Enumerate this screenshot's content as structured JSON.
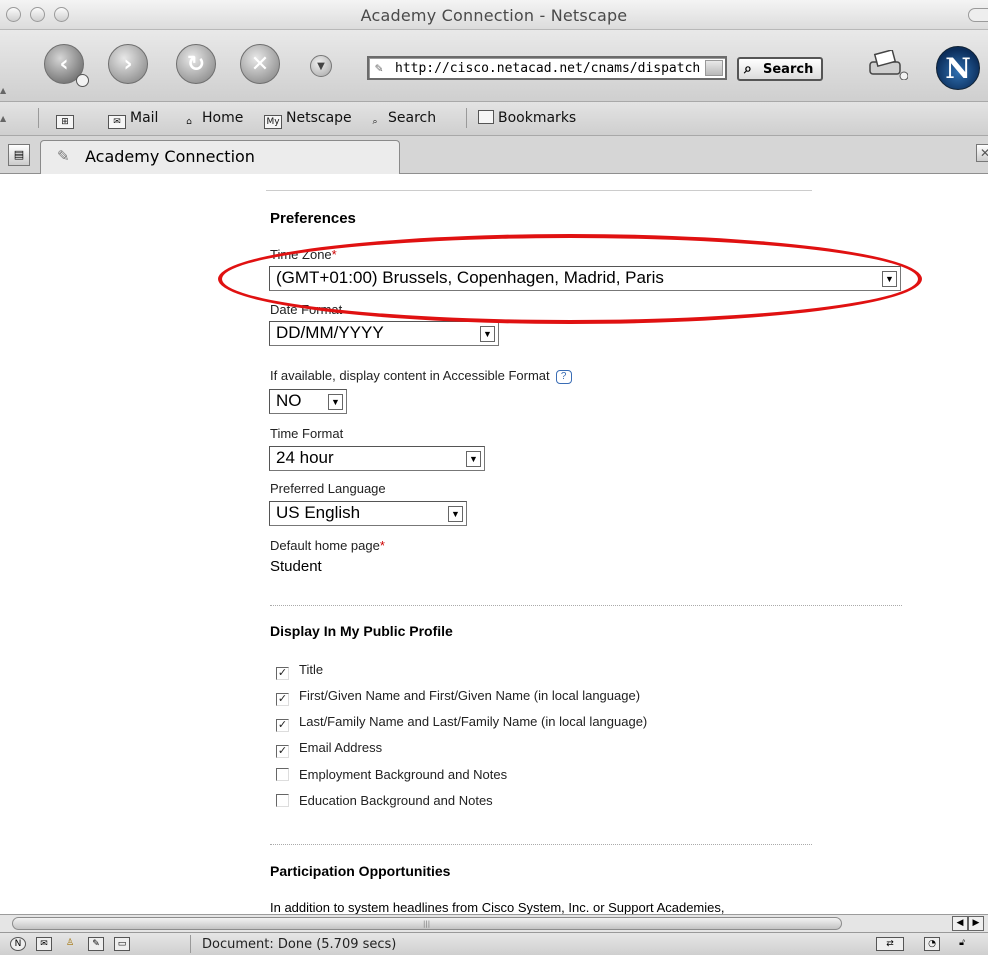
{
  "window": {
    "title": "Academy Connection - Netscape"
  },
  "navigation": {
    "url": "http://cisco.netacad.net/cnams/dispatch",
    "search_button": "Search"
  },
  "personal_toolbar": {
    "items": [
      {
        "label": "Mail",
        "icon": "mail-icon"
      },
      {
        "label": "Home",
        "icon": "home-icon"
      },
      {
        "label": "Netscape",
        "icon": "my-netscape-icon"
      },
      {
        "label": "Search",
        "icon": "search-icon"
      },
      {
        "label": "Bookmarks",
        "icon": "bookmarks-icon"
      }
    ]
  },
  "tab": {
    "title": "Academy Connection"
  },
  "preferences": {
    "heading": "Preferences",
    "time_zone": {
      "label": "Time Zone",
      "value": "(GMT+01:00) Brussels, Copenhagen, Madrid, Paris"
    },
    "date_format": {
      "label": "Date Format",
      "value": "DD/MM/YYYY"
    },
    "accessible": {
      "label": "If available, display content in Accessible Format",
      "value": "NO"
    },
    "time_format": {
      "label": "Time Format",
      "value": "24 hour"
    },
    "language": {
      "label": "Preferred Language",
      "value": "US English"
    },
    "home_page": {
      "label": "Default home page",
      "value": "Student"
    }
  },
  "public_profile": {
    "heading": "Display In My Public Profile",
    "options": [
      {
        "label": "Title",
        "checked": true
      },
      {
        "label": "First/Given Name and First/Given Name (in local language)",
        "checked": true
      },
      {
        "label": "Last/Family Name and Last/Family Name (in local language)",
        "checked": true
      },
      {
        "label": "Email Address",
        "checked": true
      },
      {
        "label": "Employment Background and Notes",
        "checked": false
      },
      {
        "label": "Education Background and Notes",
        "checked": false
      }
    ]
  },
  "participation": {
    "heading": "Participation Opportunities",
    "text": "In addition to system headlines from Cisco System, Inc. or Support Academies,"
  },
  "status_bar": {
    "text": "Document: Done (5.709 secs)"
  },
  "colors": {
    "highlight_ellipse": "#e01111",
    "required_mark": "#cc0000"
  }
}
